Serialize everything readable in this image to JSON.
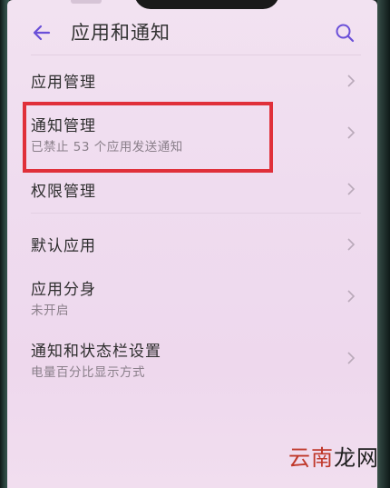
{
  "header": {
    "title": "应用和通知"
  },
  "items": [
    {
      "label": "应用管理",
      "sub": ""
    },
    {
      "label": "通知管理",
      "sub": "已禁止 53 个应用发送通知"
    },
    {
      "label": "权限管理",
      "sub": ""
    },
    {
      "label": "默认应用",
      "sub": ""
    },
    {
      "label": "应用分身",
      "sub": "未开启"
    },
    {
      "label": "通知和状态栏设置",
      "sub": "电量百分比显示方式"
    }
  ],
  "watermark": {
    "part1": "云南",
    "part2": "龙网"
  },
  "colors": {
    "accent": "#6a4fd8",
    "highlight": "#e0303a",
    "background": "#f0dcef"
  },
  "icons": {
    "back": "arrow-left-icon",
    "search": "search-icon",
    "chevron": "chevron-right-icon"
  }
}
